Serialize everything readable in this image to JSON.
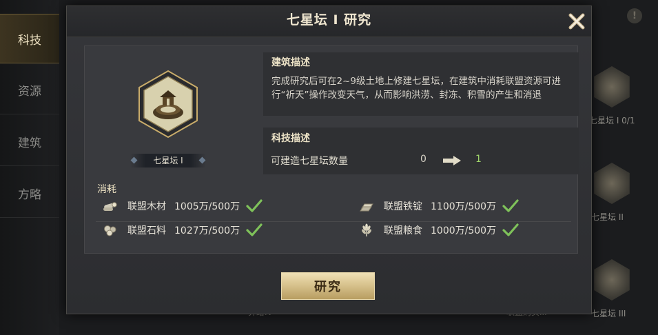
{
  "sidebar": {
    "tabs": [
      {
        "label": "科技",
        "active": true
      },
      {
        "label": "资源",
        "active": false
      },
      {
        "label": "建筑",
        "active": false
      },
      {
        "label": "方略",
        "active": false
      }
    ]
  },
  "background": {
    "right_nodes": [
      "七星坛 I 0/1",
      "七星坛 II",
      "七星坛 III"
    ],
    "bottom_labels": [
      "算给IV",
      "联盟购买III"
    ]
  },
  "dialog": {
    "title": "七星坛 I 研究",
    "building_name": "七星坛 I",
    "building_desc_title": "建筑描述",
    "building_desc_text": "完成研究后可在2~9级土地上修建七星坛，在建筑中消耗联盟资源可进行“祈天”操作改变天气，从而影响洪涝、封冻、积雪的产生和消退",
    "tech_desc_title": "科技描述",
    "stat": {
      "label": "可建造七星坛数量",
      "from": "0",
      "to": "1"
    },
    "consume_label": "消耗",
    "resources": [
      {
        "name": "联盟木材",
        "amount": "1005万/500万",
        "icon": "wood-icon"
      },
      {
        "name": "联盟铁锭",
        "amount": "1100万/500万",
        "icon": "iron-ingot-icon"
      },
      {
        "name": "联盟石料",
        "amount": "1027万/500万",
        "icon": "stone-icon"
      },
      {
        "name": "联盟粮食",
        "amount": "1000万/500万",
        "icon": "grain-icon"
      }
    ],
    "research_button": "研究"
  },
  "colors": {
    "accent_gold": "#d8c38e",
    "check_green": "#7fc25a",
    "stat_to_green": "#9fd36a"
  }
}
